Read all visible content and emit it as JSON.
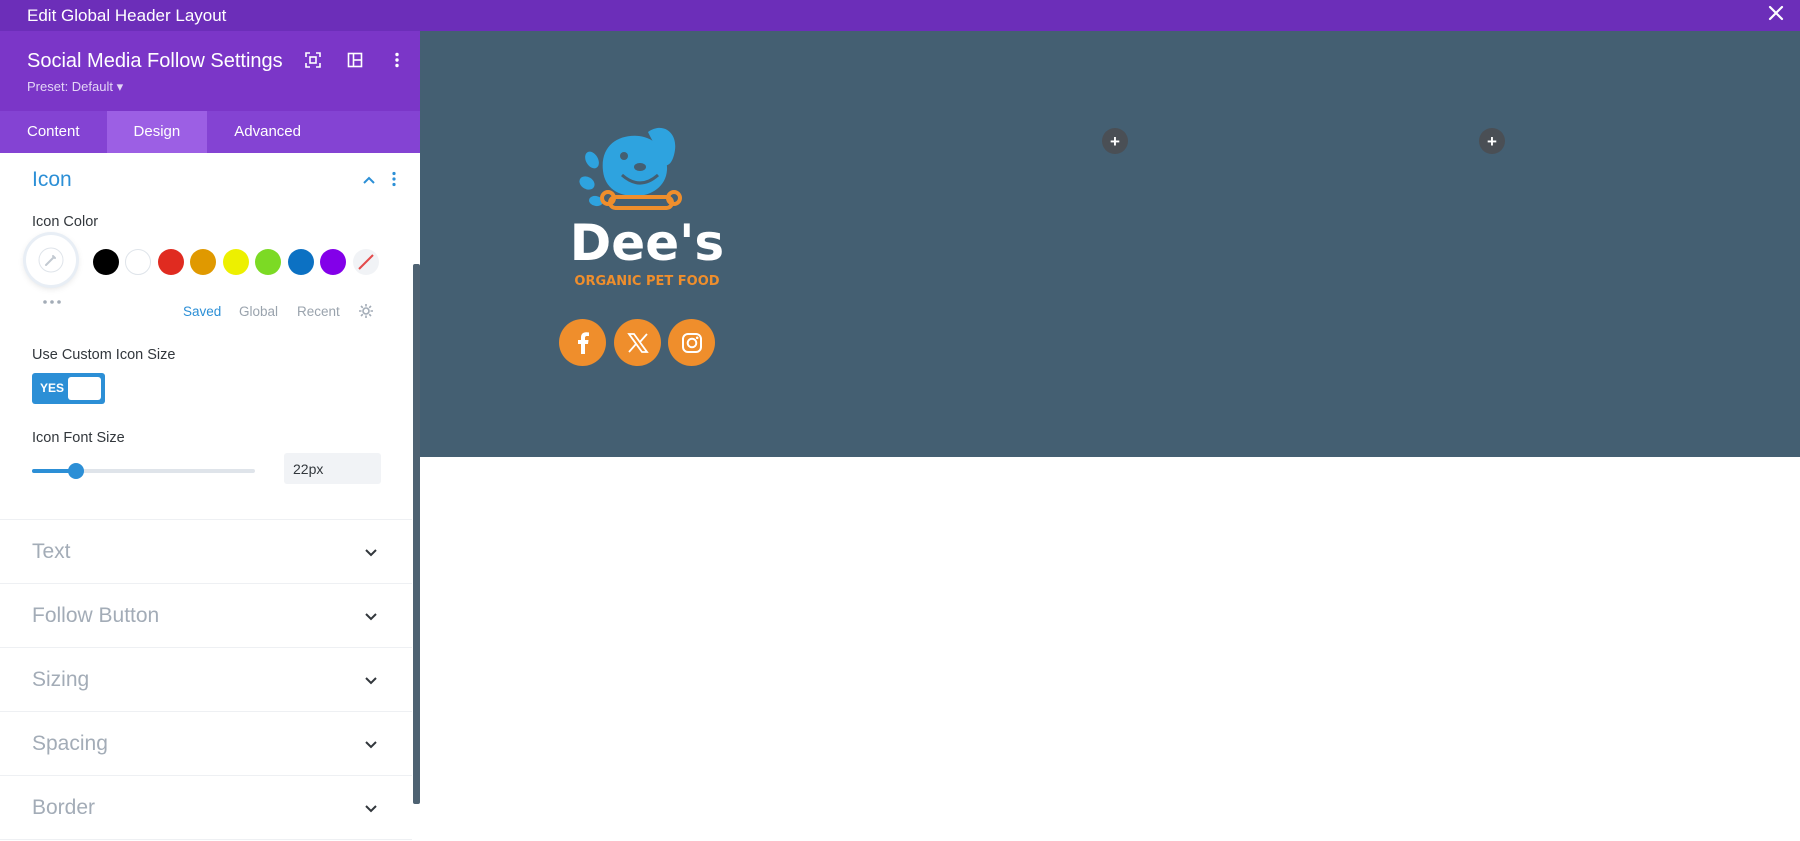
{
  "topbar": {
    "title": "Edit Global Header Layout",
    "close_icon": "close-icon"
  },
  "panel": {
    "title": "Social Media Follow Settings",
    "preset": "Preset: Default ▾",
    "tabs": [
      {
        "label": "Content"
      },
      {
        "label": "Design"
      },
      {
        "label": "Advanced"
      }
    ],
    "active_tab": "Design"
  },
  "icon_section": {
    "title": "Icon",
    "icon_color": {
      "label": "Icon Color",
      "swatches": [
        "#000000",
        "#ffffff",
        "#e02b20",
        "#e09900",
        "#edf000",
        "#7cda24",
        "#0c71c3",
        "#8300e9"
      ],
      "tabs": [
        "Saved",
        "Global",
        "Recent"
      ],
      "active": "Saved"
    },
    "custom_size": {
      "label": "Use Custom Icon Size",
      "value": "YES"
    },
    "font_size": {
      "label": "Icon Font Size",
      "value": "22px",
      "slider_fraction": 0.2
    }
  },
  "collapsed_sections": [
    {
      "title": "Text"
    },
    {
      "title": "Follow Button"
    },
    {
      "title": "Sizing"
    },
    {
      "title": "Spacing"
    },
    {
      "title": "Border"
    }
  ],
  "canvas": {
    "logo": {
      "name": "Dee's",
      "tagline": "ORGANIC PET FOOD"
    },
    "socials": [
      {
        "icon": "facebook-icon"
      },
      {
        "icon": "x-twitter-icon"
      },
      {
        "icon": "instagram-icon"
      }
    ],
    "add_buttons": [
      "+",
      "+"
    ]
  },
  "colors": {
    "topbar": "#6c2eb9",
    "accent": "#2c8fd6",
    "section_bg": "#445f72",
    "social_bg": "#ef8e2c",
    "logo_blue": "#2ea3df"
  }
}
